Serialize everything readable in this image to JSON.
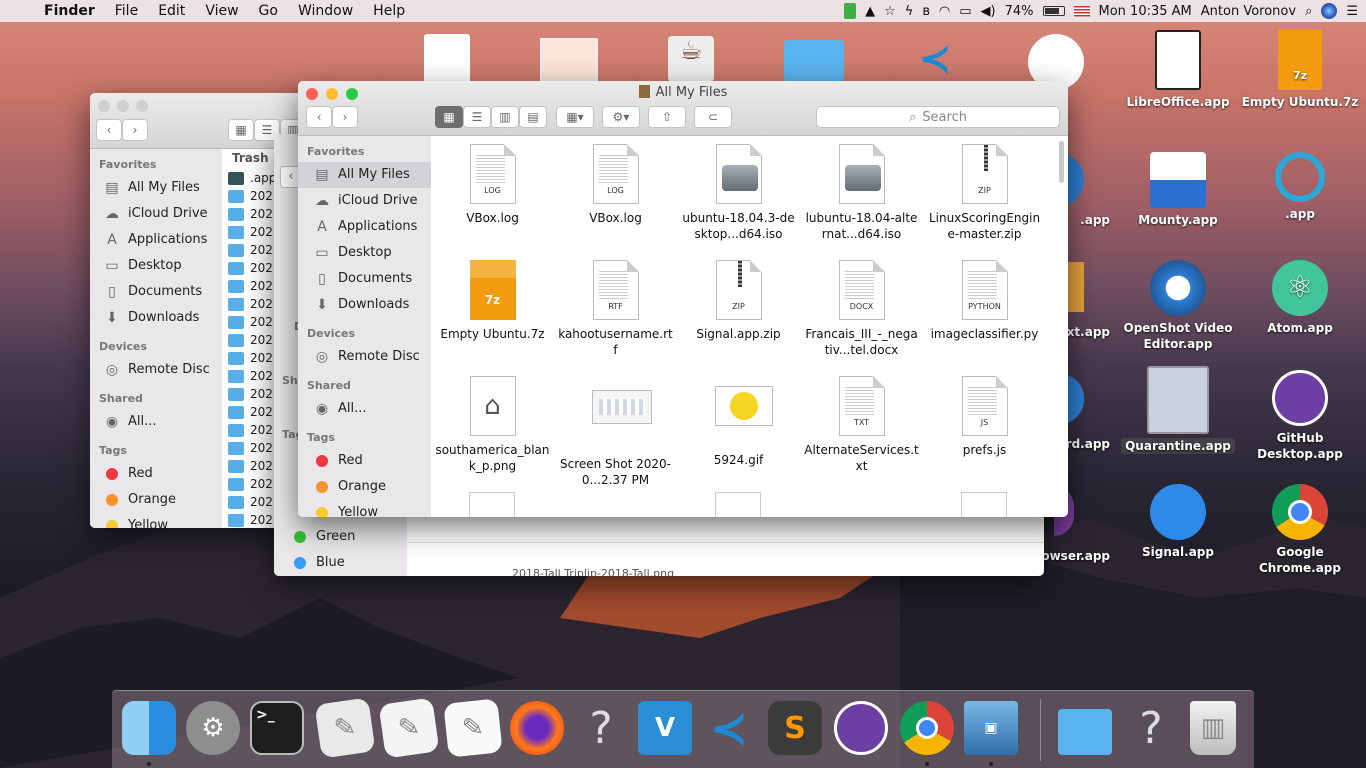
{
  "menubar": {
    "app": "Finder",
    "items": [
      "File",
      "Edit",
      "View",
      "Go",
      "Window",
      "Help"
    ],
    "battery": "74%",
    "clock": "Mon 10:35 AM",
    "user": "Anton Voronov"
  },
  "desktop": {
    "icons": [
      {
        "label": "LibreOffice.app"
      },
      {
        "label": "Empty Ubuntu.7z"
      },
      {
        "label": "Mounty.app"
      },
      {
        "label": ".app"
      },
      {
        "label": "OpenShot Video Editor.app"
      },
      {
        "label": "Atom.app"
      },
      {
        "label": "Quarantine.app"
      },
      {
        "label": "GitHub Desktop.app"
      },
      {
        "label": "Signal.app"
      },
      {
        "label": "Google Chrome.app"
      }
    ],
    "partial_labels": [
      ".app",
      ".app",
      "xt.app",
      "rd.app",
      "owser.app"
    ]
  },
  "back_window": {
    "column_header": "Trash",
    "sidebar": {
      "favorites_header": "Favorites",
      "favorites": [
        "All My Files",
        "iCloud Drive",
        "Applications",
        "Desktop",
        "Documents",
        "Downloads"
      ],
      "devices_header": "Devices",
      "devices": [
        "Remote Disc"
      ],
      "shared_header": "Shared",
      "shared": [
        "All..."
      ],
      "tags_header": "Tags",
      "tags": [
        "Red",
        "Orange",
        "Yellow"
      ]
    },
    "list": [
      ".app",
      "202",
      "202",
      "202",
      "202",
      "202",
      "202",
      "202",
      "202",
      "202",
      "202",
      "202",
      "202",
      "202",
      "202",
      "202",
      "202",
      "202",
      "202",
      "202"
    ]
  },
  "middle_window": {
    "tags": [
      "Green",
      "Blue"
    ],
    "partial_headers": [
      "De",
      "Sh",
      "Tag"
    ],
    "bottom_text": "2018-Tall Triplip-2018-Tall.png"
  },
  "front_window": {
    "title": "All My Files",
    "search_placeholder": "Search",
    "sidebar": {
      "favorites_header": "Favorites",
      "favorites": [
        "All My Files",
        "iCloud Drive",
        "Applications",
        "Desktop",
        "Documents",
        "Downloads"
      ],
      "devices_header": "Devices",
      "devices": [
        "Remote Disc"
      ],
      "shared_header": "Shared",
      "shared": [
        "All..."
      ],
      "tags_header": "Tags",
      "tags": [
        "Red",
        "Orange",
        "Yellow"
      ]
    },
    "files": [
      {
        "name": "VBox.log",
        "tag": "LOG"
      },
      {
        "name": "VBox.log",
        "tag": "LOG"
      },
      {
        "name": "ubuntu-18.04.3-desktop...d64.iso",
        "tag": ""
      },
      {
        "name": "lubuntu-18.04-alternat...d64.iso",
        "tag": ""
      },
      {
        "name": "LinuxScoringEngine-master.zip",
        "tag": "ZIP"
      },
      {
        "name": "Empty Ubuntu.7z",
        "tag": "7z"
      },
      {
        "name": "kahootusername.rtf",
        "tag": "RTF"
      },
      {
        "name": "Signal.app.zip",
        "tag": "ZIP"
      },
      {
        "name": "Francais_III_-_negativ...tel.docx",
        "tag": "DOCX"
      },
      {
        "name": "imageclassifier.py",
        "tag": "PYTHON"
      },
      {
        "name": "southamerica_blank_p.png",
        "tag": ""
      },
      {
        "name": "Screen Shot 2020-0...2.37 PM",
        "tag": ""
      },
      {
        "name": "5924.gif",
        "tag": ""
      },
      {
        "name": "AlternateServices.txt",
        "tag": "TXT"
      },
      {
        "name": "prefs.js",
        "tag": "JS"
      }
    ]
  },
  "dock": {
    "apps": [
      "Finder",
      "System Preferences",
      "Terminal",
      "Script Editor",
      "TextEdit",
      "TextEdit",
      "Firefox",
      "?",
      "VMware Fusion",
      "Visual Studio Code",
      "Sublime Text",
      "GitHub Desktop",
      "Google Chrome",
      "VirtualBox",
      "Folder",
      "?",
      "Trash"
    ],
    "terminal_prompt": ">_",
    "vm_label": "V",
    "unknown": "?"
  },
  "colors": {
    "red": "#ff5f57",
    "yellow": "#ffbd2e",
    "green": "#28c940",
    "tag_red": "#f0373f",
    "tag_orange": "#f7922c",
    "tag_yellow": "#f5cb31",
    "tag_green": "#3bbf3f",
    "tag_blue": "#3a9bf4"
  }
}
